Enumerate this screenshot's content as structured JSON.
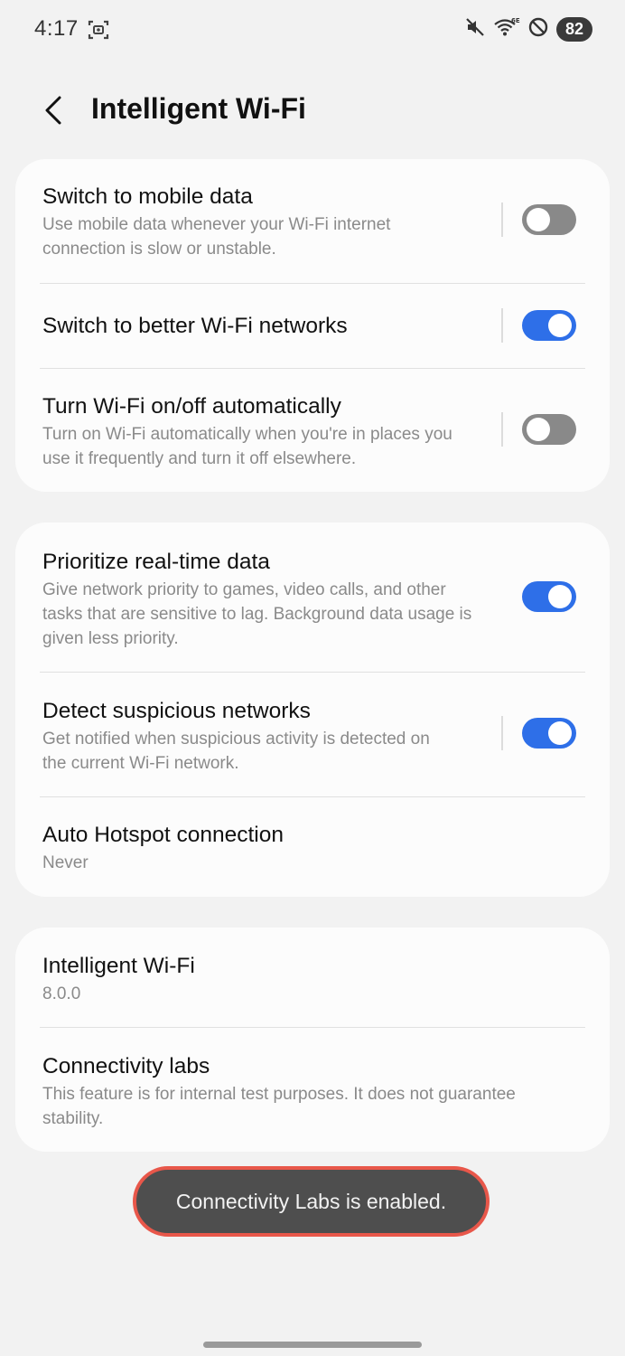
{
  "status_bar": {
    "time": "4:17",
    "battery": "82",
    "icons": [
      "screenshot-icon",
      "mute-icon",
      "wifi-6e-icon",
      "do-not-disturb-icon"
    ]
  },
  "header": {
    "title": "Intelligent Wi-Fi",
    "back_icon": "back-arrow-icon"
  },
  "card1": {
    "mobile_data": {
      "title": "Switch to mobile data",
      "sub1": "Use mobile data whenever your Wi-Fi internet",
      "sub2": "connection is slow or unstable.",
      "enabled": false
    },
    "better_wifi": {
      "title": "Switch to better Wi-Fi networks",
      "enabled": true
    },
    "wifi_auto": {
      "title": "Turn Wi-Fi on/off automatically",
      "sub1": "Turn on Wi-Fi automatically when you're in places you",
      "sub2": "use it frequently and turn it off elsewhere.",
      "enabled": false
    }
  },
  "card2": {
    "realtime": {
      "title": "Prioritize real-time data",
      "sub1": "Give network priority to games, video calls, and other",
      "sub2": "tasks that are sensitive to lag. Background data usage is",
      "sub3": "given less priority.",
      "enabled": true
    },
    "suspicious": {
      "title": "Detect suspicious networks",
      "sub1": "Get notified when suspicious activity is detected on",
      "sub2": "the current Wi-Fi network.",
      "enabled": true
    },
    "hotspot": {
      "title": "Auto Hotspot connection",
      "value": "Never"
    }
  },
  "card3": {
    "about": {
      "title": "Intelligent Wi-Fi",
      "version": "8.0.0"
    },
    "labs": {
      "title": "Connectivity labs",
      "sub1": "This feature is for internal test purposes. It does not guarantee",
      "sub2": "stability."
    }
  },
  "toast": {
    "message": "Connectivity Labs is enabled."
  },
  "colors": {
    "toggle_on": "#2e6fe8",
    "toggle_off": "#898989",
    "toast_border": "#e8574a",
    "background": "#f2f2f2"
  }
}
